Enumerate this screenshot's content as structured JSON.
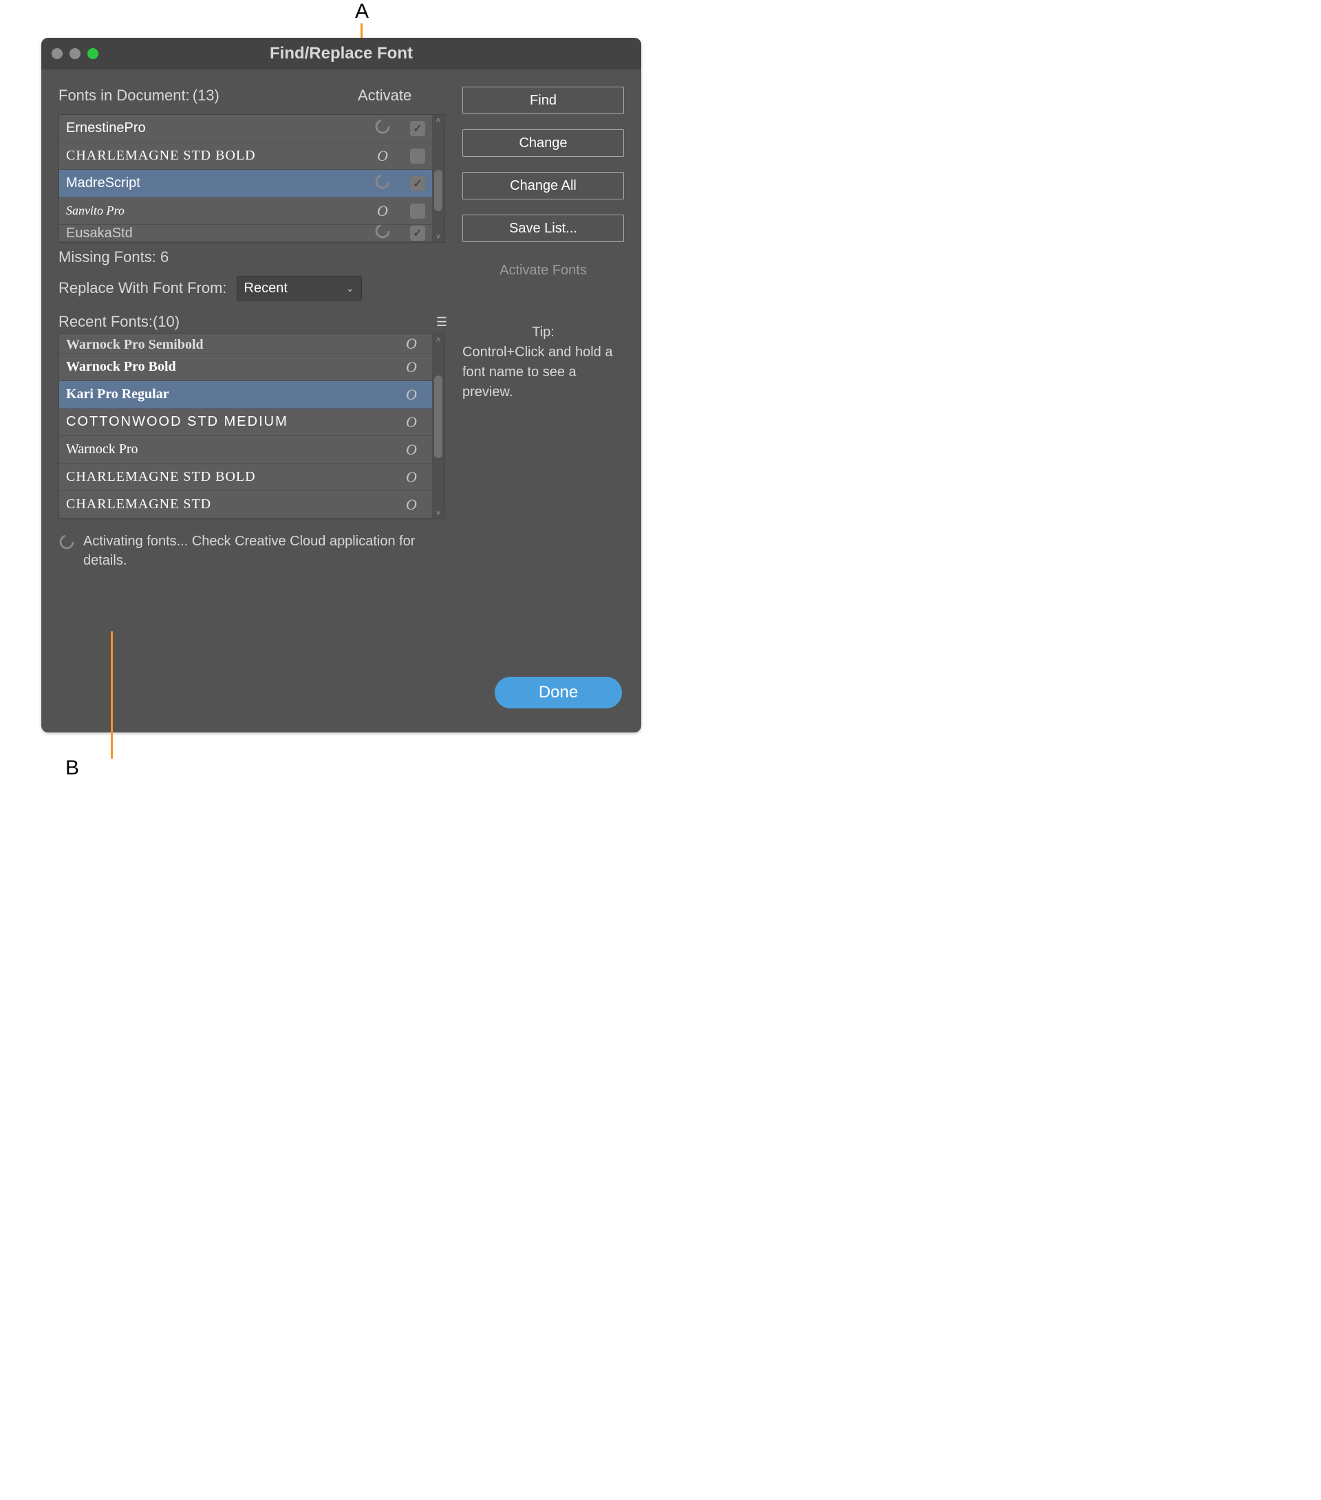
{
  "callouts": {
    "a": "A",
    "b": "B"
  },
  "window": {
    "title": "Find/Replace Font"
  },
  "fonts_in_doc": {
    "label": "Fonts in Document:",
    "count": "(13)",
    "activate_label": "Activate",
    "rows": [
      {
        "name": "ErnestinePro",
        "glyph": "spinner",
        "checked": true,
        "css": "ff-ernestine",
        "selected": false
      },
      {
        "name": "CHARLEMAGNE STD BOLD",
        "glyph": "O",
        "checked": false,
        "css": "ff-charlemagne",
        "selected": false
      },
      {
        "name": "MadreScript",
        "glyph": "spinner",
        "checked": true,
        "css": "ff-madre",
        "selected": true
      },
      {
        "name": "Sanvito Pro",
        "glyph": "O",
        "checked": false,
        "css": "ff-sanvito",
        "selected": false
      },
      {
        "name": "EusakaStd",
        "glyph": "spinner",
        "checked": true,
        "css": "ff-eusaka",
        "selected": false
      }
    ]
  },
  "missing": {
    "label": "Missing Fonts:",
    "count": "6"
  },
  "replace": {
    "label": "Replace With Font From:",
    "dropdown_value": "Recent"
  },
  "recent": {
    "label": "Recent Fonts:",
    "count": "(10)",
    "rows": [
      {
        "name": "Warnock Pro Semibold",
        "glyph": "O",
        "css": "ff-warnock-semi",
        "selected": false
      },
      {
        "name": "Warnock Pro Bold",
        "glyph": "O",
        "css": "ff-warnock-bold",
        "selected": false
      },
      {
        "name": "Kari Pro Regular",
        "glyph": "O",
        "css": "ff-kari",
        "selected": true
      },
      {
        "name": "COTTONWOOD STD MEDIUM",
        "glyph": "O",
        "css": "ff-cotton",
        "selected": false
      },
      {
        "name": "Warnock Pro",
        "glyph": "O",
        "css": "ff-warnock",
        "selected": false
      },
      {
        "name": "CHARLEMAGNE STD BOLD",
        "glyph": "O",
        "css": "ff-charlemagne",
        "selected": false
      },
      {
        "name": "CHARLEMAGNE STD",
        "glyph": "O",
        "css": "ff-charlemagne",
        "selected": false
      }
    ]
  },
  "status": "Activating fonts... Check Creative Cloud application for details.",
  "buttons": {
    "find": "Find",
    "change": "Change",
    "change_all": "Change All",
    "save_list": "Save List...",
    "activate_fonts": "Activate Fonts",
    "done": "Done"
  },
  "tip": {
    "head": "Tip:",
    "body": "Control+Click and hold a font name to see a preview."
  }
}
